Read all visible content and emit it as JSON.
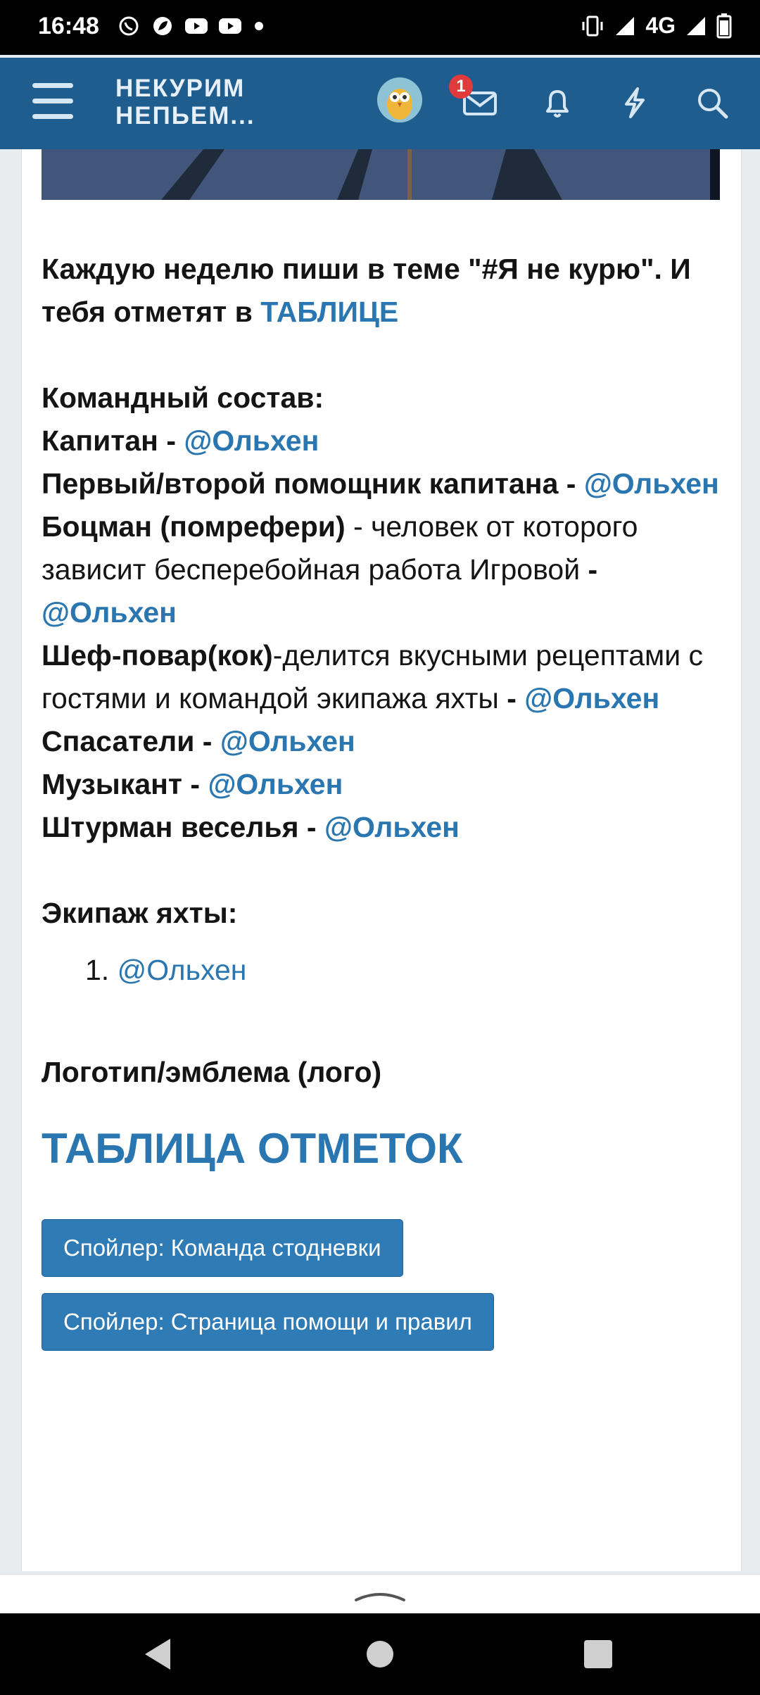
{
  "status_bar": {
    "time": "16:48",
    "network": "4G",
    "icons_left": [
      "whatsapp-icon",
      "leaf-icon",
      "youtube-icon",
      "youtube-icon"
    ],
    "icons_right": [
      "vibrate-icon",
      "signal-icon",
      "signal-icon",
      "battery-icon"
    ]
  },
  "header": {
    "logo_line1": "НЕКУРИМ",
    "logo_line2": "НЕПЬЕМ...",
    "messages_badge": "1",
    "colors": {
      "bar": "#1f5d8e",
      "badge": "#e03a3a"
    }
  },
  "post": {
    "intro_text": "Каждую неделю пиши в теме \"#Я не курю\". И тебя отметят в",
    "intro_link": "ТАБЛИЦЕ",
    "team_heading": "Командный состав:",
    "captain_role": "Капитан -",
    "captain_user": "@Ольхен",
    "assistant_role": "Первый/второй помощник капитана -",
    "assistant_user": "@Ольхен",
    "bosun_role": "Боцман (помрефери)",
    "bosun_desc": " - человек от которого зависит бесперебойная работа Игровой ",
    "bosun_dash": "-",
    "bosun_user": "@Ольхен",
    "chef_role": "Шеф-повар(кок)",
    "chef_desc": "-делится вкусными рецептами с гостями и командой экипажа яхты ",
    "chef_dash": "-",
    "chef_user": "@Ольхен",
    "rescuers_role": "Спасатели -",
    "rescuers_user": "@Ольхен",
    "musician_role": "Музыкант -",
    "musician_user": "@Ольхен",
    "navigator_role": "Штурман веселья -",
    "navigator_user": "@Ольхен",
    "crew_heading": "Экипаж яхты:",
    "crew_items": [
      {
        "num": "1.",
        "user": "@Ольхен"
      }
    ],
    "logo_heading": "Логотип/эмблема (лого)",
    "table_heading": "ТАБЛИЦА ОТМЕТОК",
    "spoiler1": "Спойлер: Команда стодневки",
    "spoiler2": "Спойлер: Страница помощи и правил",
    "colors": {
      "link": "#2a76b0",
      "spoiler_bg": "#2f7bb5"
    }
  }
}
